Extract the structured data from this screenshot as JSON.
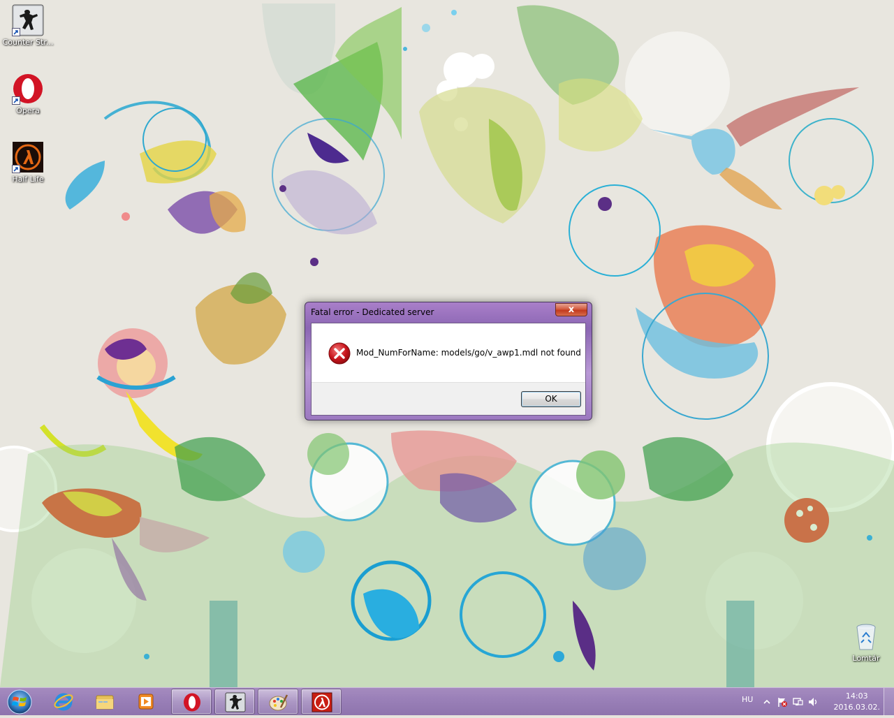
{
  "desktop_icons": [
    {
      "label": "Counter Str...",
      "icon": "counter-strike-icon"
    },
    {
      "label": "Opera",
      "icon": "opera-icon"
    },
    {
      "label": "Half Life",
      "icon": "half-life-icon"
    },
    {
      "label": "Lomtár",
      "icon": "recycle-bin-icon"
    }
  ],
  "dialog": {
    "title": "Fatal error - Dedicated server",
    "close_label": "x",
    "message": "Mod_NumForName: models/go/v_awp1.mdl not found",
    "ok_label": "OK",
    "icon": "error-icon"
  },
  "taskbar": {
    "items": [
      {
        "name": "internet-explorer",
        "icon": "internet-explorer-icon",
        "running": false
      },
      {
        "name": "windows-explorer",
        "icon": "folder-icon",
        "running": false
      },
      {
        "name": "media-player",
        "icon": "media-player-icon",
        "running": false
      },
      {
        "name": "opera",
        "icon": "opera-icon",
        "running": true
      },
      {
        "name": "counter-strike",
        "icon": "counter-strike-icon",
        "running": true
      },
      {
        "name": "paint",
        "icon": "paint-icon",
        "running": true
      },
      {
        "name": "half-life",
        "icon": "half-life-icon",
        "running": true
      }
    ]
  },
  "tray": {
    "language": "HU",
    "time": "14:03",
    "date": "2016.03.02."
  },
  "colors": {
    "taskbar": "#9a80b8",
    "dialog_frame": "#a97fc9",
    "close_button": "#c23a1e",
    "error_red": "#c8161d"
  }
}
